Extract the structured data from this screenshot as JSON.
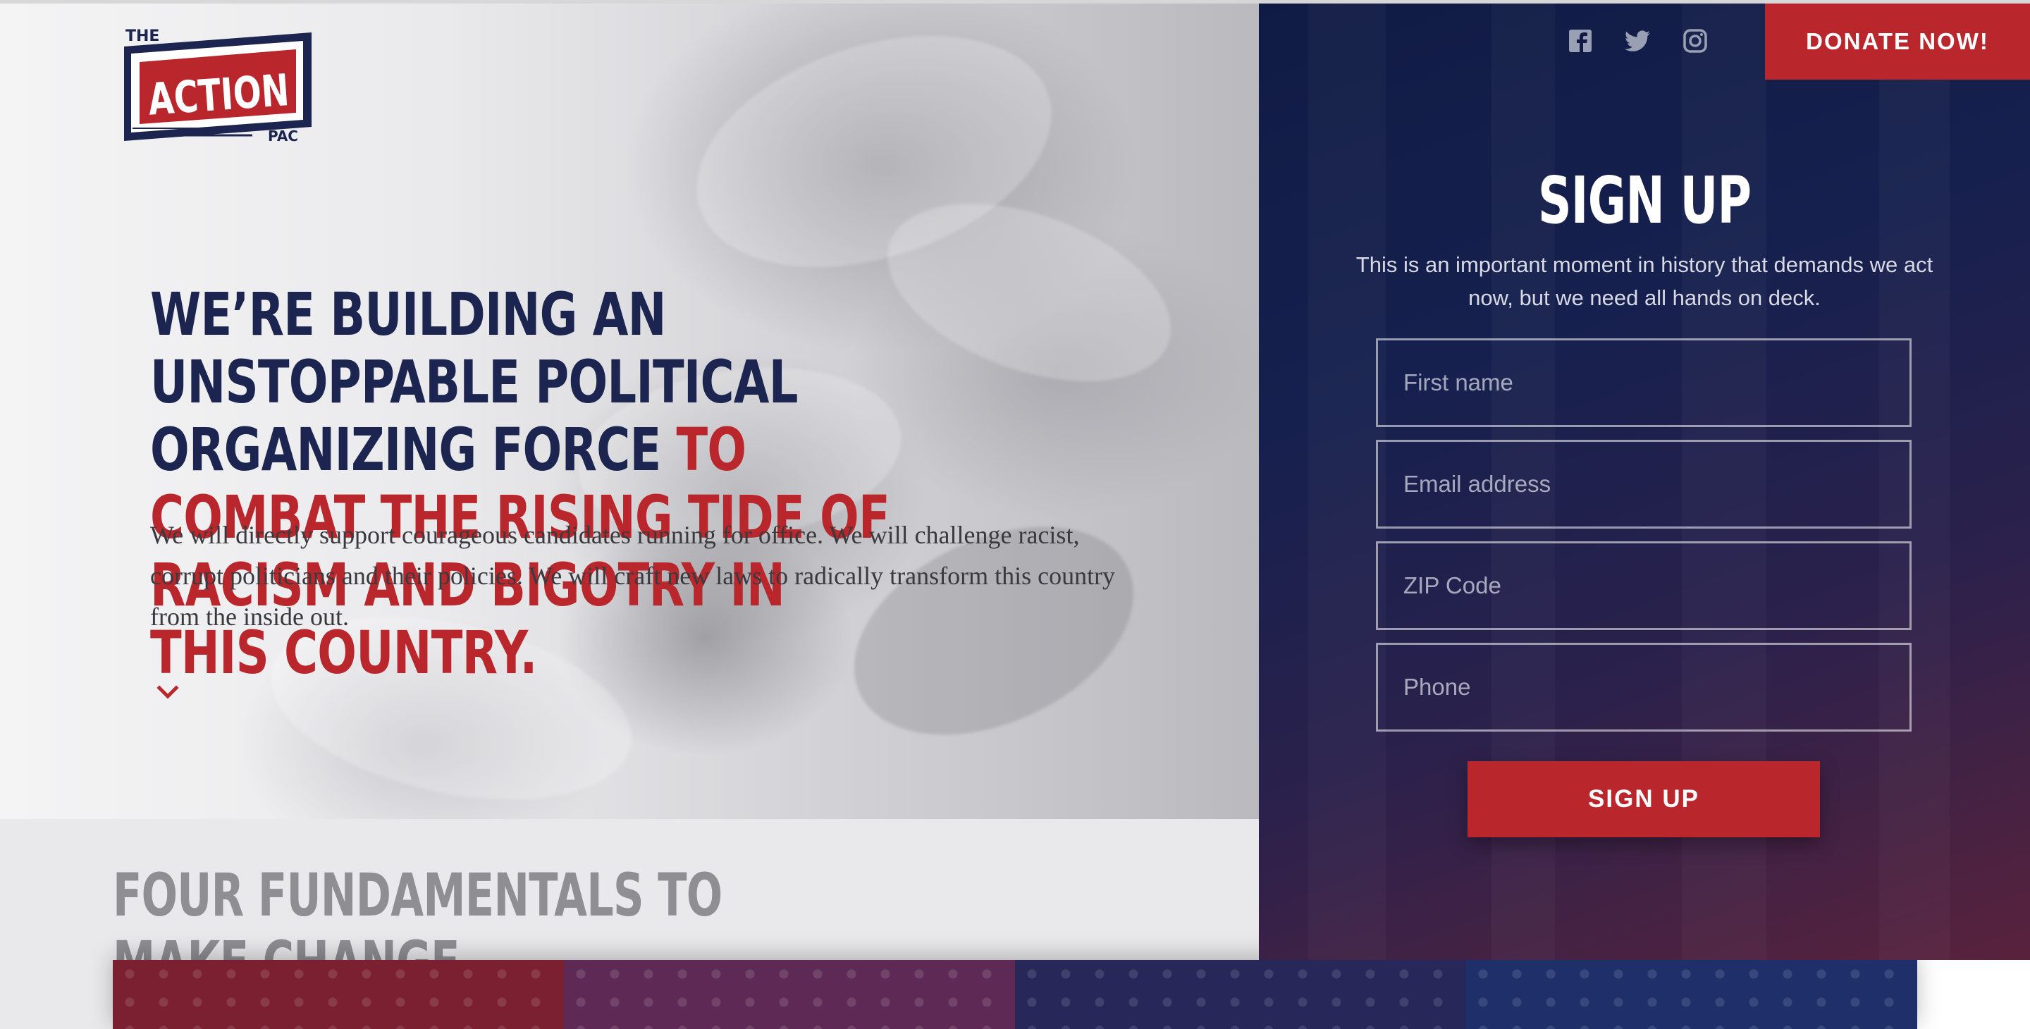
{
  "brand": {
    "logo_the": "THE",
    "logo_action": "ACTION",
    "logo_pac": "PAC"
  },
  "hero": {
    "headline_navy": "We’re building an unstoppable political organizing force ",
    "headline_red": "to combat the rising tide of racism and bigotry in this country.",
    "body": "We will directly support courageous candidates running for office. We will challenge racist, corrupt politicians and their policies. We will craft new laws to radically transform this country from the inside out."
  },
  "fundamentals": {
    "title": "Four Fundamentals to Make Change",
    "card_colors": [
      "#7a2030",
      "#5e2a55",
      "#27275a",
      "#1e2f6a"
    ]
  },
  "header": {
    "social": [
      "facebook-icon",
      "twitter-icon",
      "instagram-icon"
    ],
    "donate_label": "DONATE NOW!"
  },
  "signup": {
    "title": "SIGN UP",
    "description": "This is an important moment in history that demands we act now, but we need all hands on deck.",
    "first_name_placeholder": "First name",
    "email_placeholder": "Email address",
    "zip_placeholder": "ZIP Code",
    "phone_placeholder": "Phone",
    "button_label": "SIGN UP"
  },
  "colors": {
    "navy": "#1b2550",
    "red": "#b9272d",
    "panel": "#101b45"
  }
}
